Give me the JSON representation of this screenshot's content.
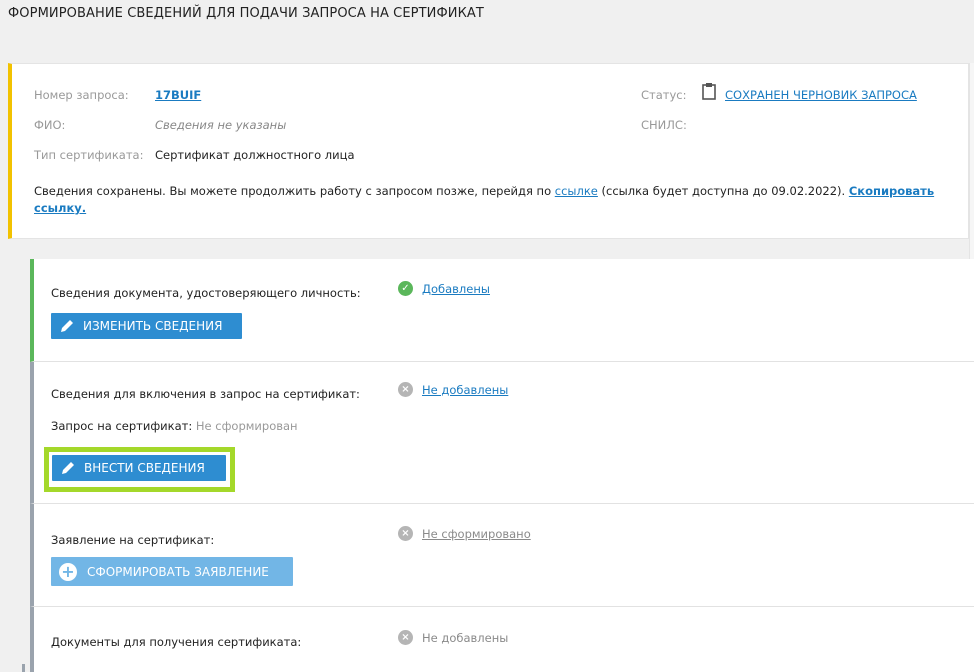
{
  "page_title": "ФОРМИРОВАНИЕ СВЕДЕНИЙ ДЛЯ ПОДАЧИ ЗАПРОСА НА СЕРТИФИКАТ",
  "request": {
    "number_label": "Номер запроса:",
    "number_value": "17BUIF",
    "fio_label": "ФИО:",
    "fio_value": "Сведения не указаны",
    "type_label": "Тип сертификата:",
    "type_value": "Сертификат должностного лица",
    "status_label": "Статус:",
    "status_value": "СОХРАНЕН ЧЕРНОВИК ЗАПРОСА",
    "status_icon": "clipboard-icon",
    "snils_label": "СНИЛС:"
  },
  "note": {
    "text_before": "Сведения сохранены. Вы можете продолжить работу с запросом позже, перейдя по ",
    "link_text": "ссылке",
    "text_after": " (ссылка будет доступна до 09.02.2022). ",
    "copy_link_text": "Скопировать ссылку."
  },
  "sections": [
    {
      "label": "Сведения документа, удостоверяющего личность:",
      "status": "Добавлены",
      "status_icon": "check-circle-icon",
      "button": "ИЗМЕНИТЬ СВЕДЕНИЯ",
      "button_icon": "pencil-icon"
    },
    {
      "label": "Сведения для включения в запрос на сертификат:",
      "status": "Не добавлены",
      "status_icon": "x-circle-icon",
      "sub_label": "Запрос на сертификат:",
      "sub_value": "Не сформирован",
      "button": "ВНЕСТИ СВЕДЕНИЯ",
      "button_icon": "pencil-icon"
    },
    {
      "label": "Заявление на сертификат:",
      "status": "Не сформировано",
      "status_icon": "x-circle-icon",
      "button": "СФОРМИРОВАТЬ ЗАЯВЛЕНИЕ",
      "button_icon": "plus-circle-icon"
    },
    {
      "label": "Документы для получения сертификата:",
      "status": "Не добавлены",
      "status_icon": "x-circle-icon"
    }
  ],
  "colors": {
    "accent_blue": "#2e8dd1",
    "warning_bar": "#f2c200",
    "success_green": "#5bb75b",
    "highlight_green": "#a4d82a"
  }
}
